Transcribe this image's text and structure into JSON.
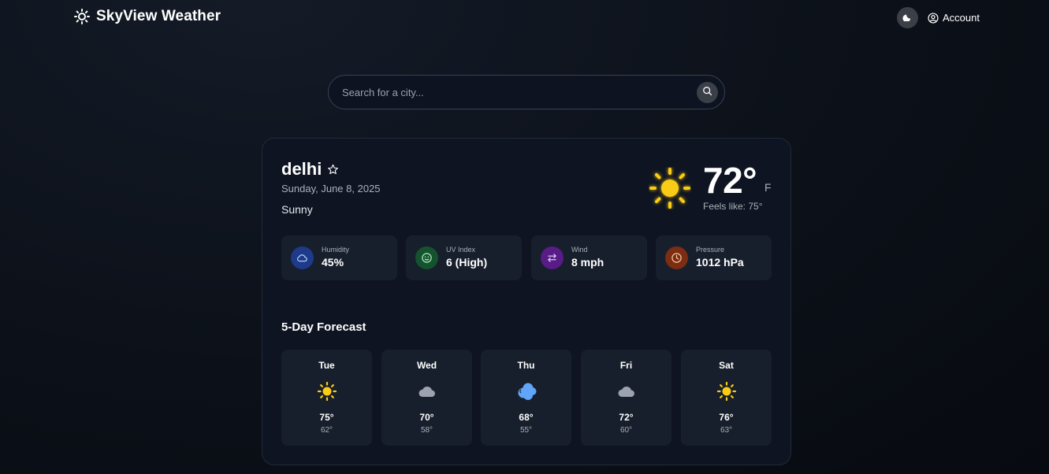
{
  "header": {
    "brand_name": "SkyView Weather",
    "brand_icon": "sun-icon",
    "theme_toggle_icon": "moon-icon",
    "account_label": "Account",
    "account_icon": "user-circle-icon"
  },
  "search": {
    "placeholder": "Search for a city...",
    "value": "",
    "icon": "search-icon"
  },
  "current": {
    "city": "delhi",
    "favorite_icon": "star-outline-icon",
    "date": "Sunday, June 8, 2025",
    "condition": "Sunny",
    "condition_icon": "sun-icon",
    "temperature": "72°",
    "unit": "F",
    "feels_like": "Feels like: 75°"
  },
  "stats": [
    {
      "label": "Humidity",
      "value": "45%",
      "icon": "cloud-icon",
      "color": "#1e3a8a"
    },
    {
      "label": "UV Index",
      "value": "6 (High)",
      "icon": "smile-icon",
      "color": "#14532d"
    },
    {
      "label": "Wind",
      "value": "8 mph",
      "icon": "arrows-exchange-icon",
      "color": "#581c87"
    },
    {
      "label": "Pressure",
      "value": "1012 hPa",
      "icon": "clock-icon",
      "color": "#7c2d12"
    }
  ],
  "forecast": {
    "title": "5-Day Forecast",
    "days": [
      {
        "day": "Tue",
        "icon": "sun-icon",
        "high": "75°",
        "low": "62°"
      },
      {
        "day": "Wed",
        "icon": "cloud-icon",
        "high": "70°",
        "low": "58°"
      },
      {
        "day": "Thu",
        "icon": "cloud-rain-icon",
        "high": "68°",
        "low": "55°"
      },
      {
        "day": "Fri",
        "icon": "cloud-icon",
        "high": "72°",
        "low": "60°"
      },
      {
        "day": "Sat",
        "icon": "sun-icon",
        "high": "76°",
        "low": "63°"
      }
    ]
  },
  "colors": {
    "accent_sun": "#facc15",
    "cloud": "#9ca3af",
    "rain_cloud": "#60a5fa",
    "panel": "#181f2c",
    "card": "#0e1421"
  }
}
